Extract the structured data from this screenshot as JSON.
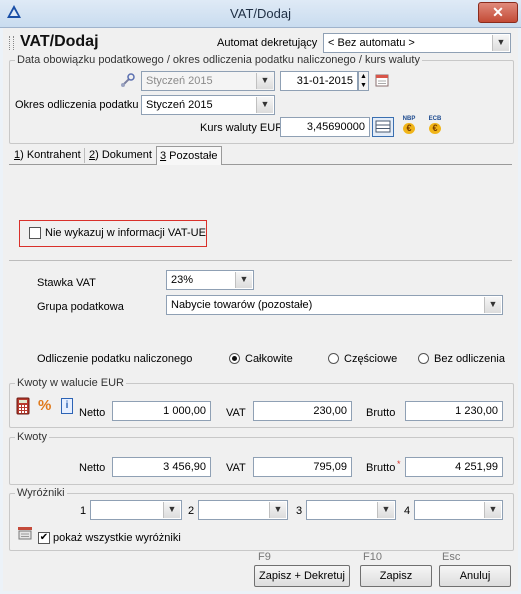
{
  "window": {
    "title": "VAT/Dodaj",
    "close_glyph": "✕"
  },
  "header": {
    "heading": "VAT/Dodaj",
    "automat_label": "Automat dekretujący",
    "automat_value": "< Bez automatu >"
  },
  "dates": {
    "group_label": "Data obowiązku podatkowego / okres odliczenia podatku naliczonego / kurs waluty",
    "period_value": "Styczeń 2015",
    "date_value": "31-01-2015",
    "okres_label": "Okres odliczenia podatku",
    "okres_value": "Styczeń 2015",
    "kurs_label": "Kurs waluty EUR",
    "kurs_value": "3,45690000",
    "nbp_label": "NBP",
    "ecb_label": "ECB",
    "euro_glyph": "€"
  },
  "tabs": [
    {
      "num": "1",
      "label": ") Kontrahent"
    },
    {
      "num": "2",
      "label": ") Dokument"
    },
    {
      "num": "3",
      "label": " Pozostałe"
    }
  ],
  "vatue": {
    "checkbox_label": "Nie wykazuj w informacji VAT-UE",
    "checked": false
  },
  "vat": {
    "stawka_label": "Stawka VAT",
    "stawka_value": "23%",
    "grupa_label": "Grupa podatkowa",
    "grupa_value": "Nabycie towarów (pozostałe)",
    "odliczenie_label": "Odliczenie podatku naliczonego",
    "options": [
      "Całkowite",
      "Częściowe",
      "Bez odliczenia"
    ],
    "selected": "Całkowite"
  },
  "eur": {
    "group_label": "Kwoty w walucie EUR",
    "percent_glyph": "%",
    "info_glyph": "i",
    "netto_label": "Netto",
    "netto": "1 000,00",
    "vat_label": "VAT",
    "vat": "230,00",
    "brutto_label": "Brutto",
    "brutto": "1 230,00"
  },
  "pln": {
    "group_label": "Kwoty",
    "netto_label": "Netto",
    "netto": "3 456,90",
    "vat_label": "VAT",
    "vat": "795,09",
    "brutto_label": "Brutto",
    "brutto_marker": "*",
    "brutto": "4 251,99"
  },
  "wyrozniki": {
    "group_label": "Wyróżniki",
    "slots": [
      "1",
      "2",
      "3",
      "4"
    ],
    "show_all_label": "pokaż wszystkie wyróżniki",
    "show_all_checked": true
  },
  "buttons": {
    "zapisz_dekretuj": {
      "key": "F9",
      "label": "Zapisz + Dekretuj"
    },
    "zapisz": {
      "key": "F10",
      "label": "Zapisz"
    },
    "anuluj": {
      "key": "Esc",
      "label": "Anuluj"
    }
  },
  "colors": {
    "accent_red": "#d9302a",
    "title_bg": "#c9dcef",
    "check_mark": "✔"
  }
}
